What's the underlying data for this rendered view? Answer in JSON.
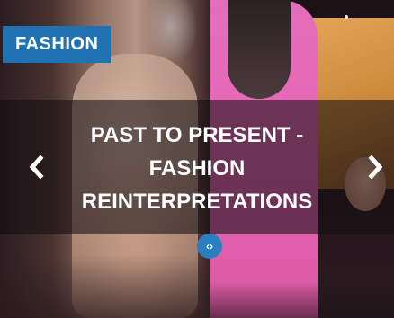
{
  "category_badge": "FASHION",
  "title_lines": [
    "PAST TO PRESENT -",
    "FASHION",
    "REINTERPRETATIONS"
  ],
  "navigation": {
    "prev_icon": "chevron-left",
    "next_icon": "chevron-right"
  },
  "comparison_handle": {
    "icon": "left-right-arrows",
    "glyph": "‹›"
  },
  "colors": {
    "badge_bg": "#1f73b3",
    "handle_bg": "#2a7fc1",
    "text": "#ffffff"
  }
}
